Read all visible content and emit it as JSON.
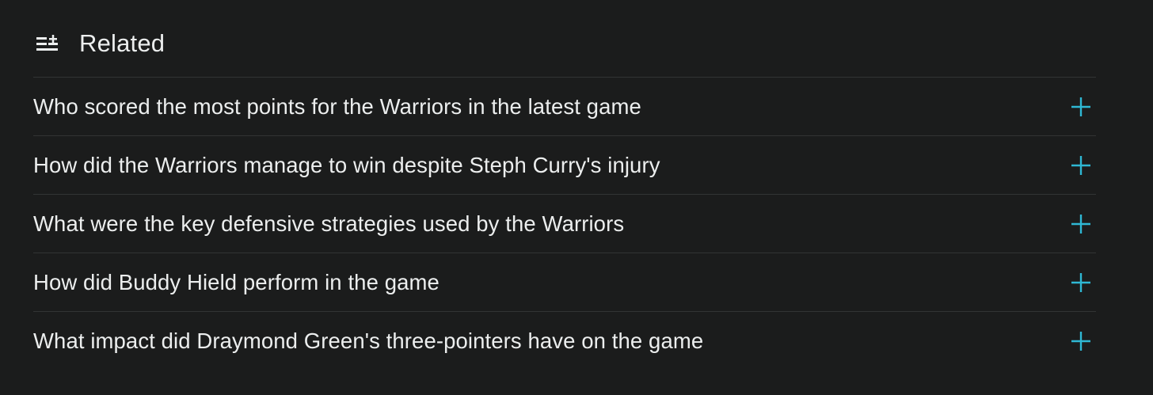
{
  "related": {
    "icon": "list-plus-icon",
    "title": "Related",
    "accent_color": "#2fb8d4",
    "items": [
      {
        "label": "Who scored the most points for the Warriors in the latest game",
        "action_icon": "plus-icon"
      },
      {
        "label": "How did the Warriors manage to win despite Steph Curry's injury",
        "action_icon": "plus-icon"
      },
      {
        "label": "What were the key defensive strategies used by the Warriors",
        "action_icon": "plus-icon"
      },
      {
        "label": "How did Buddy Hield perform in the game",
        "action_icon": "plus-icon"
      },
      {
        "label": "What impact did Draymond Green's three-pointers have on the game",
        "action_icon": "plus-icon"
      }
    ]
  }
}
